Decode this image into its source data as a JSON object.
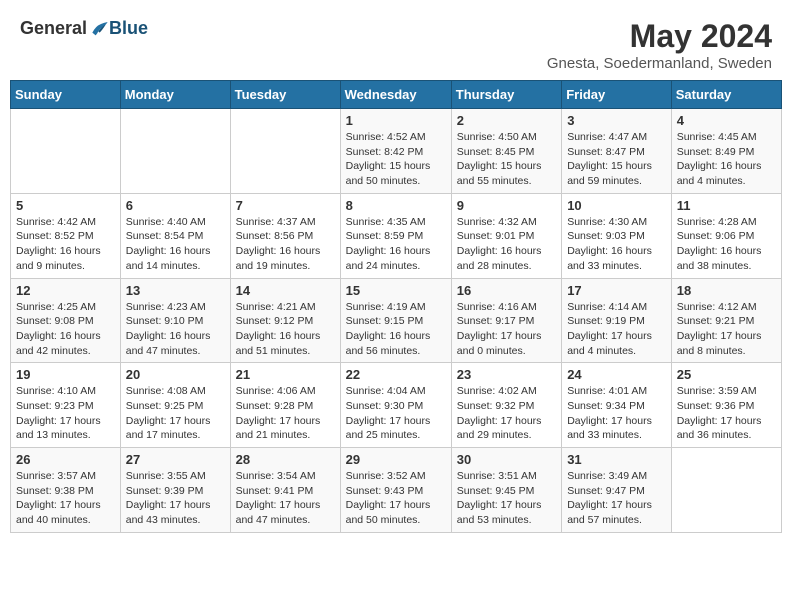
{
  "header": {
    "logo_general": "General",
    "logo_blue": "Blue",
    "month_year": "May 2024",
    "location": "Gnesta, Soedermanland, Sweden"
  },
  "days_of_week": [
    "Sunday",
    "Monday",
    "Tuesday",
    "Wednesday",
    "Thursday",
    "Friday",
    "Saturday"
  ],
  "weeks": [
    [
      {
        "day": "",
        "info": ""
      },
      {
        "day": "",
        "info": ""
      },
      {
        "day": "",
        "info": ""
      },
      {
        "day": "1",
        "info": "Sunrise: 4:52 AM\nSunset: 8:42 PM\nDaylight: 15 hours\nand 50 minutes."
      },
      {
        "day": "2",
        "info": "Sunrise: 4:50 AM\nSunset: 8:45 PM\nDaylight: 15 hours\nand 55 minutes."
      },
      {
        "day": "3",
        "info": "Sunrise: 4:47 AM\nSunset: 8:47 PM\nDaylight: 15 hours\nand 59 minutes."
      },
      {
        "day": "4",
        "info": "Sunrise: 4:45 AM\nSunset: 8:49 PM\nDaylight: 16 hours\nand 4 minutes."
      }
    ],
    [
      {
        "day": "5",
        "info": "Sunrise: 4:42 AM\nSunset: 8:52 PM\nDaylight: 16 hours\nand 9 minutes."
      },
      {
        "day": "6",
        "info": "Sunrise: 4:40 AM\nSunset: 8:54 PM\nDaylight: 16 hours\nand 14 minutes."
      },
      {
        "day": "7",
        "info": "Sunrise: 4:37 AM\nSunset: 8:56 PM\nDaylight: 16 hours\nand 19 minutes."
      },
      {
        "day": "8",
        "info": "Sunrise: 4:35 AM\nSunset: 8:59 PM\nDaylight: 16 hours\nand 24 minutes."
      },
      {
        "day": "9",
        "info": "Sunrise: 4:32 AM\nSunset: 9:01 PM\nDaylight: 16 hours\nand 28 minutes."
      },
      {
        "day": "10",
        "info": "Sunrise: 4:30 AM\nSunset: 9:03 PM\nDaylight: 16 hours\nand 33 minutes."
      },
      {
        "day": "11",
        "info": "Sunrise: 4:28 AM\nSunset: 9:06 PM\nDaylight: 16 hours\nand 38 minutes."
      }
    ],
    [
      {
        "day": "12",
        "info": "Sunrise: 4:25 AM\nSunset: 9:08 PM\nDaylight: 16 hours\nand 42 minutes."
      },
      {
        "day": "13",
        "info": "Sunrise: 4:23 AM\nSunset: 9:10 PM\nDaylight: 16 hours\nand 47 minutes."
      },
      {
        "day": "14",
        "info": "Sunrise: 4:21 AM\nSunset: 9:12 PM\nDaylight: 16 hours\nand 51 minutes."
      },
      {
        "day": "15",
        "info": "Sunrise: 4:19 AM\nSunset: 9:15 PM\nDaylight: 16 hours\nand 56 minutes."
      },
      {
        "day": "16",
        "info": "Sunrise: 4:16 AM\nSunset: 9:17 PM\nDaylight: 17 hours\nand 0 minutes."
      },
      {
        "day": "17",
        "info": "Sunrise: 4:14 AM\nSunset: 9:19 PM\nDaylight: 17 hours\nand 4 minutes."
      },
      {
        "day": "18",
        "info": "Sunrise: 4:12 AM\nSunset: 9:21 PM\nDaylight: 17 hours\nand 8 minutes."
      }
    ],
    [
      {
        "day": "19",
        "info": "Sunrise: 4:10 AM\nSunset: 9:23 PM\nDaylight: 17 hours\nand 13 minutes."
      },
      {
        "day": "20",
        "info": "Sunrise: 4:08 AM\nSunset: 9:25 PM\nDaylight: 17 hours\nand 17 minutes."
      },
      {
        "day": "21",
        "info": "Sunrise: 4:06 AM\nSunset: 9:28 PM\nDaylight: 17 hours\nand 21 minutes."
      },
      {
        "day": "22",
        "info": "Sunrise: 4:04 AM\nSunset: 9:30 PM\nDaylight: 17 hours\nand 25 minutes."
      },
      {
        "day": "23",
        "info": "Sunrise: 4:02 AM\nSunset: 9:32 PM\nDaylight: 17 hours\nand 29 minutes."
      },
      {
        "day": "24",
        "info": "Sunrise: 4:01 AM\nSunset: 9:34 PM\nDaylight: 17 hours\nand 33 minutes."
      },
      {
        "day": "25",
        "info": "Sunrise: 3:59 AM\nSunset: 9:36 PM\nDaylight: 17 hours\nand 36 minutes."
      }
    ],
    [
      {
        "day": "26",
        "info": "Sunrise: 3:57 AM\nSunset: 9:38 PM\nDaylight: 17 hours\nand 40 minutes."
      },
      {
        "day": "27",
        "info": "Sunrise: 3:55 AM\nSunset: 9:39 PM\nDaylight: 17 hours\nand 43 minutes."
      },
      {
        "day": "28",
        "info": "Sunrise: 3:54 AM\nSunset: 9:41 PM\nDaylight: 17 hours\nand 47 minutes."
      },
      {
        "day": "29",
        "info": "Sunrise: 3:52 AM\nSunset: 9:43 PM\nDaylight: 17 hours\nand 50 minutes."
      },
      {
        "day": "30",
        "info": "Sunrise: 3:51 AM\nSunset: 9:45 PM\nDaylight: 17 hours\nand 53 minutes."
      },
      {
        "day": "31",
        "info": "Sunrise: 3:49 AM\nSunset: 9:47 PM\nDaylight: 17 hours\nand 57 minutes."
      },
      {
        "day": "",
        "info": ""
      }
    ]
  ]
}
